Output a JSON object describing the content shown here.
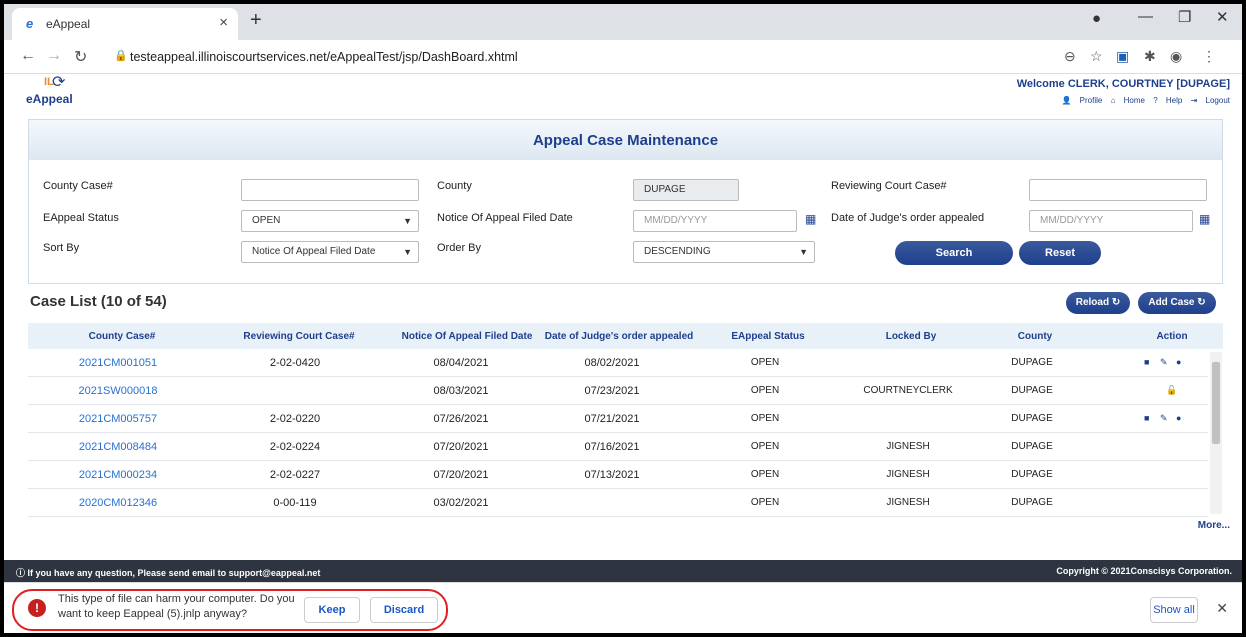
{
  "browser": {
    "tab_title": "eAppeal",
    "url": "testeappeal.illinoiscourtservices.net/eAppealTest/jsp/DashBoard.xhtml"
  },
  "header": {
    "logo_prefix": "IL",
    "logo_text": "eAppeal",
    "welcome": "Welcome CLERK, COURTNEY  [DUPAGE]",
    "links": [
      "Profile",
      "Home",
      "Help",
      "Logout"
    ]
  },
  "search": {
    "title": "Appeal Case Maintenance",
    "county_case_label": "County Case#",
    "county_label": "County",
    "county_value": "DUPAGE",
    "reviewing_case_label": "Reviewing Court Case#",
    "status_label": "EAppeal Status",
    "status_value": "OPEN",
    "filed_date_label": "Notice Of Appeal Filed Date",
    "filed_date_placeholder": "MM/DD/YYYY",
    "judge_order_label": "Date of Judge's order appealed",
    "judge_order_placeholder": "MM/DD/YYYY",
    "sort_label": "Sort By",
    "sort_value": "Notice Of Appeal Filed Date",
    "order_label": "Order By",
    "order_value": "DESCENDING",
    "search_btn": "Search",
    "reset_btn": "Reset"
  },
  "caselist": {
    "title": "Case List (10 of 54)",
    "reload_btn": "Reload",
    "add_btn": "Add Case",
    "columns": [
      "County Case#",
      "Reviewing Court Case#",
      "Notice Of Appeal Filed Date",
      "Date of Judge's order appealed",
      "EAppeal Status",
      "Locked By",
      "County",
      "Action"
    ],
    "rows": [
      {
        "case": "2021CM001051",
        "reviewing": "2-02-0420",
        "filed": "08/04/2021",
        "judge": "08/02/2021",
        "status": "OPEN",
        "locked": "",
        "county": "DUPAGE"
      },
      {
        "case": "2021SW000018",
        "reviewing": "",
        "filed": "08/03/2021",
        "judge": "07/23/2021",
        "status": "OPEN",
        "locked": "COURTNEYCLERK",
        "county": "DUPAGE"
      },
      {
        "case": "2021CM005757",
        "reviewing": "2-02-0220",
        "filed": "07/26/2021",
        "judge": "07/21/2021",
        "status": "OPEN",
        "locked": "",
        "county": "DUPAGE"
      },
      {
        "case": "2021CM008484",
        "reviewing": "2-02-0224",
        "filed": "07/20/2021",
        "judge": "07/16/2021",
        "status": "OPEN",
        "locked": "JIGNESH",
        "county": "DUPAGE"
      },
      {
        "case": "2021CM000234",
        "reviewing": "2-02-0227",
        "filed": "07/20/2021",
        "judge": "07/13/2021",
        "status": "OPEN",
        "locked": "JIGNESH",
        "county": "DUPAGE"
      },
      {
        "case": "2020CM012346",
        "reviewing": "0-00-119",
        "filed": "03/02/2021",
        "judge": "",
        "status": "OPEN",
        "locked": "JIGNESH",
        "county": "DUPAGE"
      }
    ],
    "more": "More..."
  },
  "footer": {
    "left": "If you have any question, Please send email to support@eappeal.net",
    "right": "Copyright © 2021Conscisys Corporation."
  },
  "download": {
    "message": "This type of file can harm your computer. Do you want to keep Eappeal (5).jnlp anyway?",
    "keep": "Keep",
    "discard": "Discard",
    "show_all": "Show all"
  }
}
